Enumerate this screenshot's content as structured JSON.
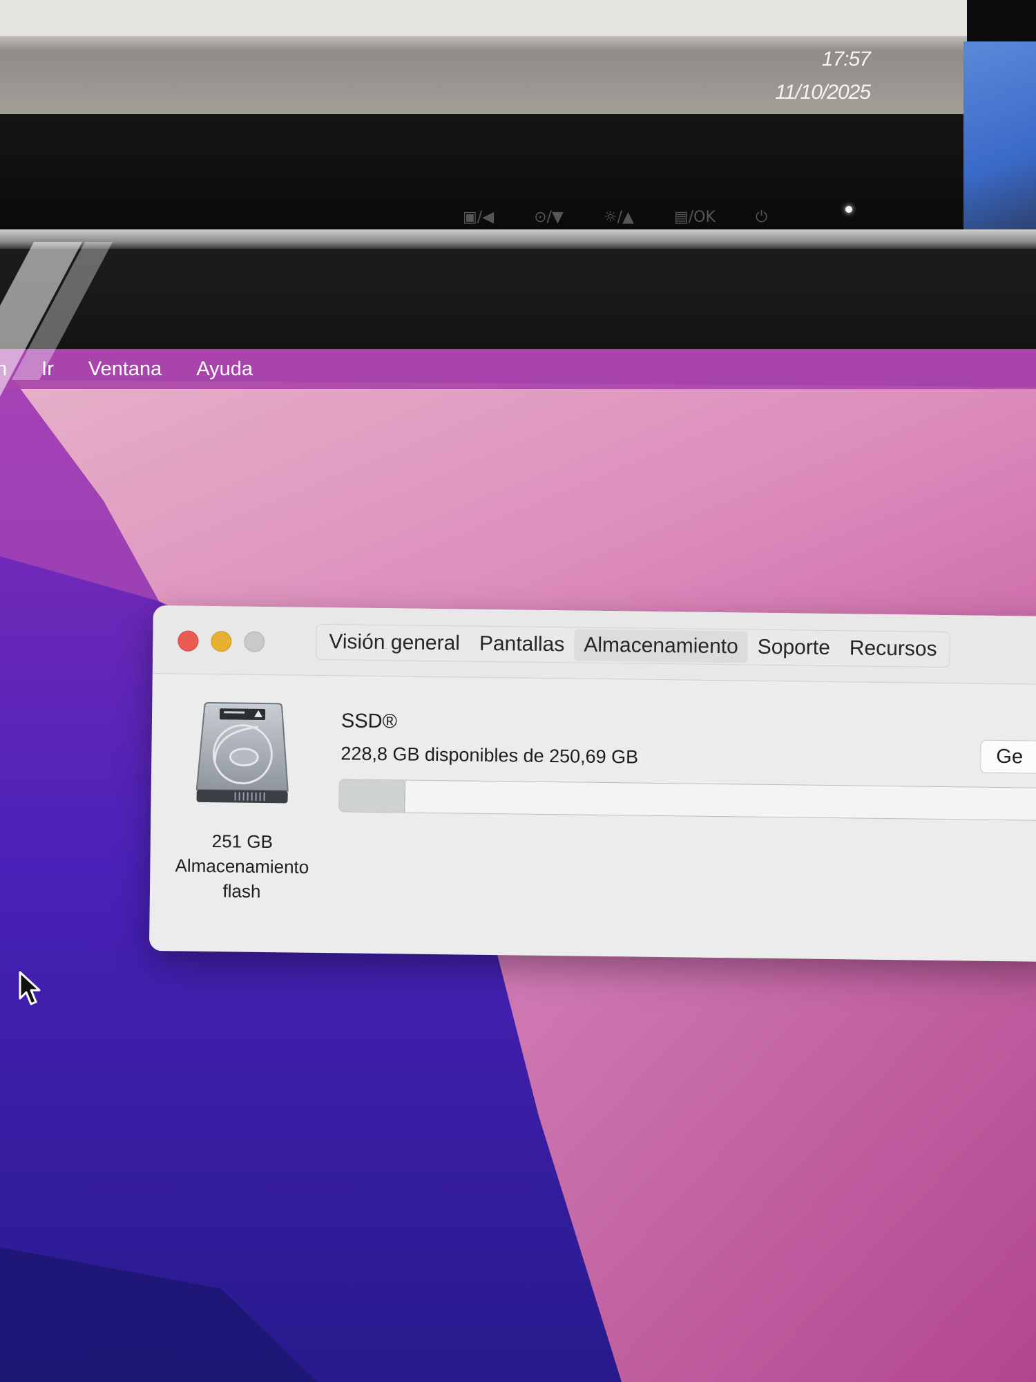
{
  "external_monitor": {
    "clock_time": "17:57",
    "clock_date": "11/10/2025",
    "buttons": [
      "▣/◀",
      "⊙/▼",
      "☼/▲",
      "▤/OK",
      "⏻"
    ]
  },
  "menubar": {
    "items": [
      "n",
      "Ir",
      "Ventana",
      "Ayuda"
    ]
  },
  "window": {
    "tabs": [
      "Visión general",
      "Pantallas",
      "Almacenamiento",
      "Soporte",
      "Recursos"
    ],
    "active_tab": "Almacenamiento",
    "drive_icon": "hard-drive-icon",
    "drive_caption": [
      "251 GB",
      "Almacenamiento",
      "flash"
    ],
    "volume_name": "SSD®",
    "volume_free": "228,8 GB disponibles de 250,69 GB",
    "used_fraction": 0.087,
    "manage_button": "Ge"
  },
  "colors": {
    "close": "#ec5b52",
    "minimize": "#e6b130",
    "zoom_disabled": "#c9c9c9",
    "menubar": "#aa46aa"
  }
}
